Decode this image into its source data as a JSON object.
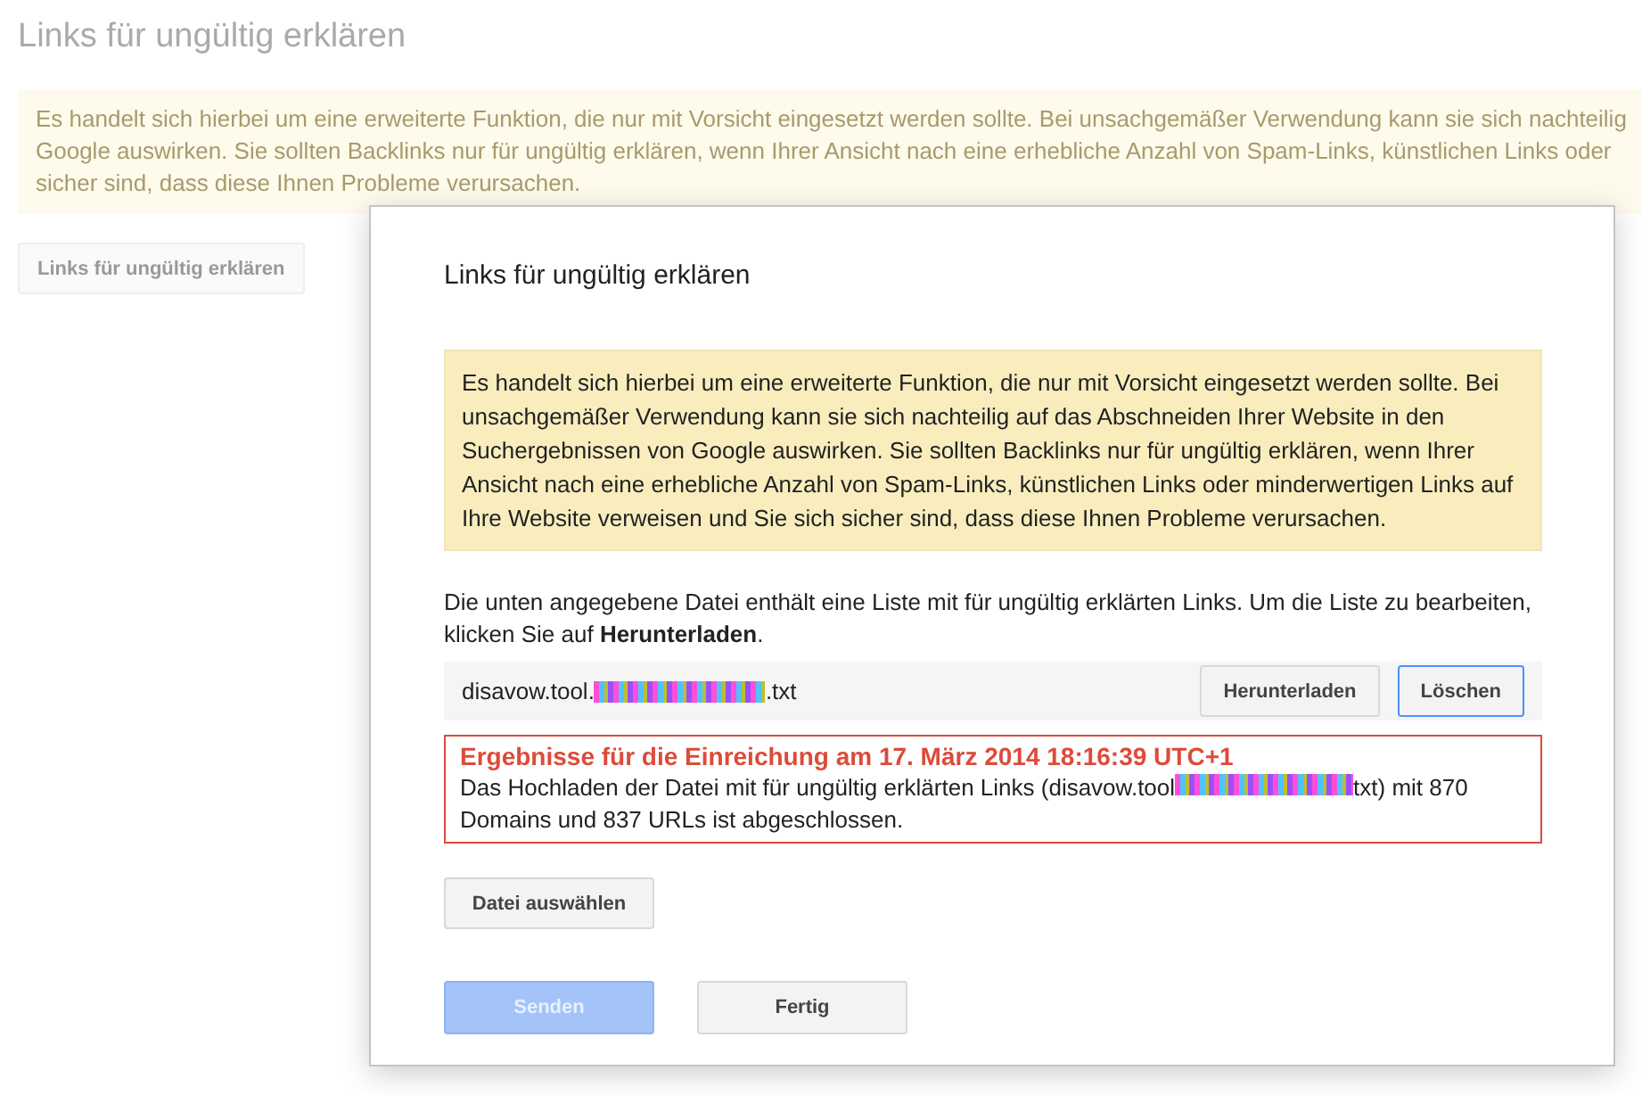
{
  "page": {
    "title": "Links für ungültig erklären",
    "warning_lines": [
      "Es handelt sich hierbei um eine erweiterte Funktion, die nur mit Vorsicht eingesetzt werden sollte. Bei unsachgemäßer Verwendung kann sie sich nachteilig",
      "Google auswirken. Sie sollten Backlinks nur für ungültig erklären, wenn Ihrer Ansicht nach eine erhebliche Anzahl von Spam-Links, künstlichen Links oder",
      "sicher sind, dass diese Ihnen Probleme verursachen."
    ],
    "button": "Links für ungültig erklären"
  },
  "dialog": {
    "title": "Links für ungültig erklären",
    "warning": "Es handelt sich hierbei um eine erweiterte Funktion, die nur mit Vorsicht eingesetzt werden sollte. Bei unsachgemäßer Verwendung kann sie sich nachteilig auf das Abschneiden Ihrer Website in den Suchergebnissen von Google auswirken. Sie sollten Backlinks nur für ungültig erklären, wenn Ihrer Ansicht nach eine erhebliche Anzahl von Spam-Links, künstlichen Links oder minderwertigen Links auf Ihre Website verweisen und Sie sich sicher sind, dass diese Ihnen Probleme verursachen.",
    "description": "Die unten angegebene Datei enthält eine Liste mit für ungültig erklärten Links. Um die Liste zu bearbeiten, klicken Sie auf **Herunterladen**.",
    "file": {
      "name_start": "disavow.tool.",
      "name_end": ".txt",
      "buttons": [
        {
          "label": "Herunterladen",
          "focused": false
        },
        {
          "label": "Löschen",
          "focused": true
        }
      ]
    },
    "result": {
      "heading": "Ergebnisse für die Einreichung am 17. März 2014 18:16:39 UTC+1",
      "text_start": "Das Hochladen der Datei mit für ungültig erklärten Links (disavow.tool",
      "text_end": "txt) mit 870 Domains und 837 URLs ist abgeschlossen."
    },
    "choose_button": "Datei auswählen",
    "footer_buttons": [
      {
        "label": "Senden",
        "disabled": true
      },
      {
        "label": "Fertig",
        "disabled": false
      }
    ]
  }
}
